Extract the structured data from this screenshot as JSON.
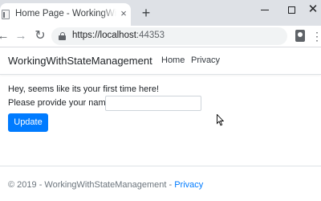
{
  "browser": {
    "tab_title": "Home Page - WorkingWithStateManagement",
    "tab_close": "×",
    "new_tab": "+",
    "url_host": "https://localhost",
    "url_port": ":44353",
    "back_icon": "←",
    "forward_icon": "→",
    "reload_icon": "↻",
    "menu_icon": "⋮",
    "close_glyph": "✕"
  },
  "site": {
    "brand": "WorkingWithStateManagement",
    "nav": [
      "Home",
      "Privacy"
    ]
  },
  "main": {
    "greeting": "Hey, seems like its your first time here!",
    "name_label": "Please provide your name:",
    "name_value": "",
    "update_label": "Update"
  },
  "footer": {
    "text": "© 2019 - WorkingWithStateManagement - ",
    "privacy_link": "Privacy"
  },
  "colors": {
    "accent": "#007bff",
    "tabstrip": "#dee1e6",
    "omnibox": "#f1f3f4"
  }
}
